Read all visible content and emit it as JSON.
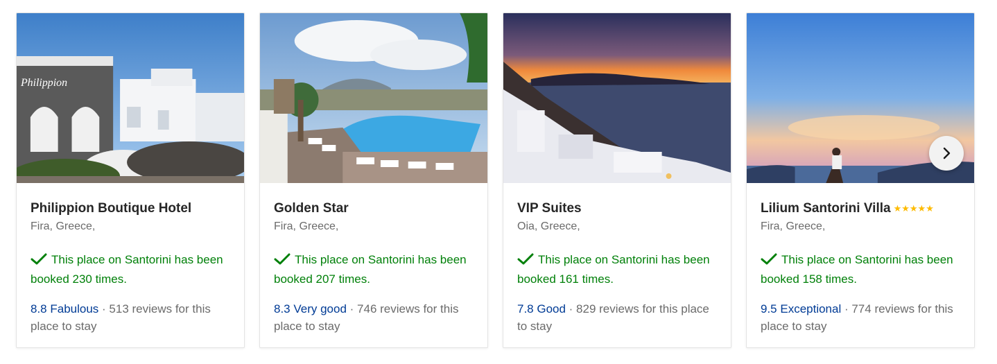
{
  "cards": [
    {
      "name": "Philippion Boutique Hotel",
      "stars": "",
      "location": "Fira, Greece,",
      "booked": "This place on Santorini has been booked 230 times.",
      "score": "8.8 Fabulous",
      "reviews": " · 513 reviews for this place to stay",
      "image": "hotel-building-photo"
    },
    {
      "name": "Golden Star",
      "stars": "",
      "location": "Fira, Greece,",
      "booked": "This place on Santorini has been booked 207 times.",
      "score": "8.3 Very good",
      "reviews": " · 746 reviews for this place to stay",
      "image": "pool-photo"
    },
    {
      "name": "VIP Suites",
      "stars": "",
      "location": "Oia, Greece,",
      "booked": "This place on Santorini has been booked 161 times.",
      "score": "7.8 Good",
      "reviews": " · 829 reviews for this place to stay",
      "image": "sunset-caldera-photo"
    },
    {
      "name": "Lilium Santorini Villa",
      "stars": "★★★★★",
      "location": "Fira, Greece,",
      "booked": "This place on Santorini has been booked 158 times.",
      "score": "9.5 Exceptional",
      "reviews": " · 774 reviews for this place to stay",
      "image": "sunset-person-photo"
    }
  ],
  "colors": {
    "booked": "#008009",
    "score": "#003b95",
    "stars": "#febb02"
  },
  "next_button_icon": "chevron-right-icon"
}
